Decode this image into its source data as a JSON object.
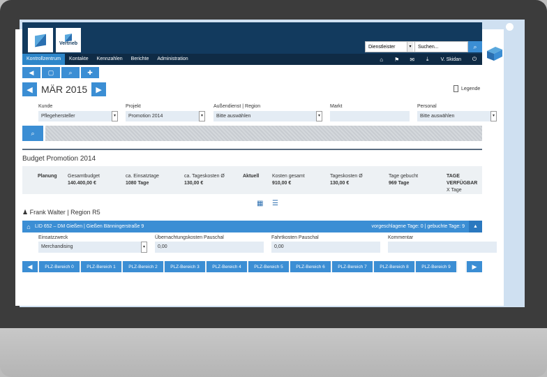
{
  "brand": {
    "sub_logo_text": "Vertrieb"
  },
  "top_search": {
    "dropdown_value": "Dienstleister",
    "placeholder": "Suchen..."
  },
  "nav": {
    "items": [
      "Kontrollzentrum",
      "Kontakte",
      "Kennzahlen",
      "Berichte",
      "Administration"
    ],
    "user": "V. Skidan"
  },
  "toolbar": {
    "icons": [
      "megaphone-icon",
      "crop-icon",
      "search-icon",
      "plus-icon"
    ]
  },
  "calendar": {
    "month": "MÄR 2015",
    "legend": "Legende"
  },
  "filters": {
    "kunde": {
      "label": "Kunde",
      "value": "Pflegehersteller"
    },
    "projekt": {
      "label": "Projekt",
      "value": "Promotion 2014"
    },
    "aussendienst": {
      "label": "Außendienst | Region",
      "value": "Bitte auswählen"
    },
    "markt": {
      "label": "Markt",
      "value": ""
    },
    "personal": {
      "label": "Personal",
      "value": "Bitte auswählen"
    }
  },
  "budget": {
    "title": "Budget Promotion 2014",
    "planung": "Planung",
    "gesamtbudget_label": "Gesamtbudget",
    "gesamtbudget_value": "140.400,00 €",
    "einsatztage_label": "ca. Einsatztage",
    "einsatztage_value": "1080 Tage",
    "tageskosten_label": "ca. Tageskosten Ø",
    "tageskosten_value": "130,00 €",
    "aktuell": "Aktuell",
    "kosten_label": "Kosten gesamt",
    "kosten_value": "910,00 €",
    "tageskosten2_label": "Tageskosten Ø",
    "tageskosten2_value": "130,00 €",
    "gebucht_label": "Tage gebucht",
    "gebucht_value": "969 Tage",
    "verfuegbar_label": "TAGE VERFÜGBAR",
    "verfuegbar_value": "X Tage"
  },
  "person": "Frank Walter | Region R5",
  "lid": {
    "title": "LID 652 – DM Gießen | Gießen Bänningerstraße 9",
    "days": "vorgeschlagene Tage: 0 | gebuchte Tage: 9"
  },
  "details": {
    "einsatzzweck": {
      "label": "Einsatzzweck",
      "value": "Merchandising"
    },
    "uebernachtung": {
      "label": "Übernachtungskosten Pauschal",
      "value": "0,00"
    },
    "fahrtkosten": {
      "label": "Fahrtkosten Pauschal",
      "value": "0,00"
    },
    "kommentar": {
      "label": "Kommentar",
      "value": ""
    }
  },
  "plz_tabs": [
    "PLZ-Bereich 0",
    "PLZ-Bereich 1",
    "PLZ-Bereich 2",
    "PLZ-Bereich 3",
    "PLZ-Bereich 4",
    "PLZ-Bereich 5",
    "PLZ-Bereich 6",
    "PLZ-Bereich 7",
    "PLZ-Bereich 8",
    "PLZ-Bereich 9"
  ],
  "colors": {
    "header": "#123a5e",
    "nav": "#0f2b45",
    "accent": "#3b8ed4"
  }
}
